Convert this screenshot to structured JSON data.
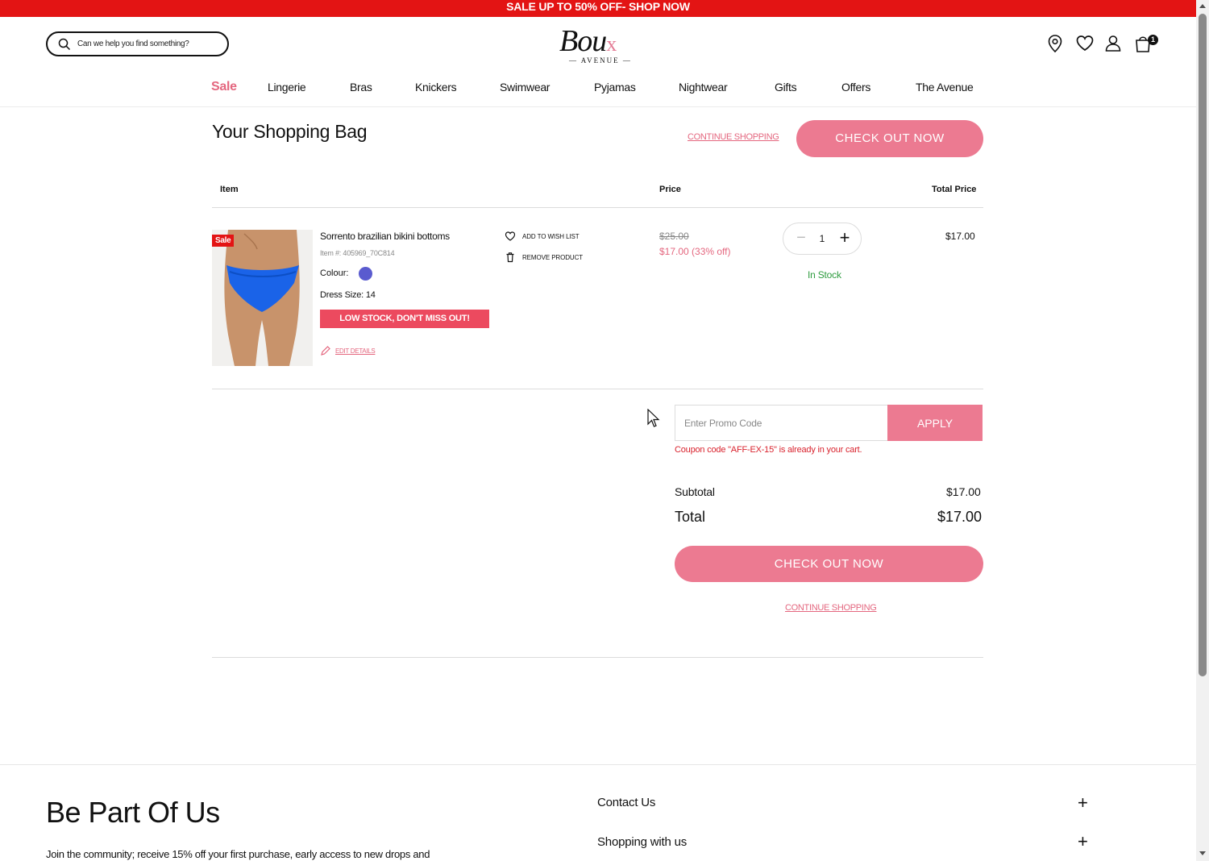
{
  "promo_bar": {
    "text": "SALE UP TO 50% OFF- SHOP NOW"
  },
  "header": {
    "search_placeholder": "Can we help you find something?",
    "logo_text": "Bou",
    "logo_x": "x",
    "logo_sub": "— AVENUE —",
    "cart_count": "1"
  },
  "nav": {
    "items": [
      "Sale",
      "Lingerie",
      "Bras",
      "Knickers",
      "Swimwear",
      "Pyjamas",
      "Nightwear",
      "Gifts",
      "Offers",
      "The Avenue"
    ]
  },
  "bag": {
    "title": "Your Shopping Bag",
    "continue_shopping": "CONTINUE SHOPPING",
    "checkout": "CHECK OUT NOW",
    "columns": {
      "item": "Item",
      "price": "Price",
      "total": "Total Price"
    }
  },
  "product": {
    "sale_tag": "Sale",
    "name": "Sorrento brazilian bikini bottoms",
    "sku": "Item #: 405969_70C814",
    "colour_label": "Colour:",
    "colour_hex": "#5a5bcf",
    "size": "Dress Size: 14",
    "low_stock": "LOW STOCK, DON'T MISS OUT!",
    "edit": "EDIT DETAILS",
    "add_wishlist": "ADD TO WISH LIST",
    "remove": "REMOVE PRODUCT",
    "price_old": "$25.00",
    "price_new": "$17.00 (33% off)",
    "quantity": "1",
    "stock": "In Stock",
    "total": "$17.00"
  },
  "summary": {
    "promo_placeholder": "Enter Promo Code",
    "apply": "APPLY",
    "coupon_msg": "Coupon code \"AFF-EX-15\" is already in your cart.",
    "subtotal_label": "Subtotal",
    "subtotal": "$17.00",
    "total_label": "Total",
    "total": "$17.00",
    "checkout": "CHECK OUT NOW",
    "continue_shopping": "CONTINUE SHOPPING"
  },
  "footer": {
    "title": "Be Part Of Us",
    "text": "Join the community; receive 15% off your first purchase, early access to new drops and",
    "accordion": [
      "Contact Us",
      "Shopping with us"
    ]
  },
  "colors": {
    "accent": "#ec7a91",
    "sale_red": "#e31414",
    "link_pink": "#e4677f",
    "in_stock": "#2e9c3f"
  }
}
